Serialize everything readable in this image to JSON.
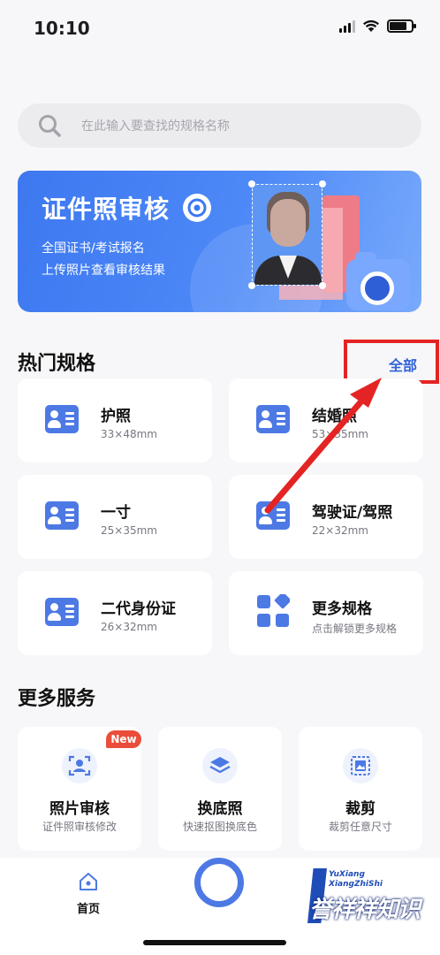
{
  "status_bar": {
    "time": "10:10"
  },
  "search": {
    "placeholder": "在此输入要查找的规格名称"
  },
  "banner": {
    "title": "证件照审核",
    "line1": "全国证书/考试报名",
    "line2": "上传照片查看审核结果"
  },
  "hot_specs": {
    "title": "热门规格",
    "view_all": "全部",
    "items": [
      {
        "name": "护照",
        "size": "33×48mm",
        "icon": "id-card-icon"
      },
      {
        "name": "结婚照",
        "size": "53×35mm",
        "icon": "id-card-icon"
      },
      {
        "name": "一寸",
        "size": "25×35mm",
        "icon": "id-card-icon"
      },
      {
        "name": "驾驶证/驾照",
        "size": "22×32mm",
        "icon": "id-card-icon"
      },
      {
        "name": "二代身份证",
        "size": "26×32mm",
        "icon": "id-card-icon"
      },
      {
        "name": "更多规格",
        "size": "点击解锁更多规格",
        "icon": "grid-icon"
      }
    ]
  },
  "more_services": {
    "title": "更多服务",
    "items": [
      {
        "name": "照片审核",
        "desc": "证件照审核修改",
        "icon": "portrait-scan-icon",
        "badge": "New"
      },
      {
        "name": "换底照",
        "desc": "快速抠图换底色",
        "icon": "layers-icon"
      },
      {
        "name": "裁剪",
        "desc": "裁剪任意尺寸",
        "icon": "image-crop-icon"
      }
    ]
  },
  "tab_bar": {
    "home_label": "首页"
  },
  "watermark": {
    "line1": "YuXiang",
    "line2": "XiangZhiShi",
    "text": "誉祥祥知识"
  },
  "colors": {
    "accent": "#4d79e4",
    "highlight_red": "#e42424",
    "banner_blue": "#3d78f0"
  }
}
